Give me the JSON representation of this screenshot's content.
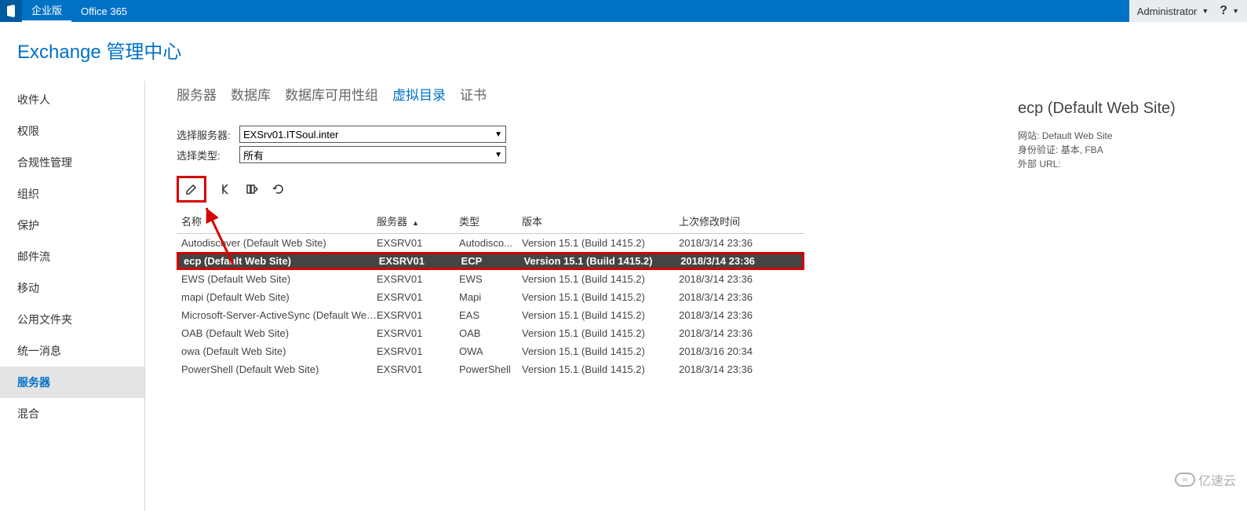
{
  "topbar": {
    "edition": "企业版",
    "office": "Office 365",
    "user": "Administrator"
  },
  "page_title": "Exchange 管理中心",
  "sidebar": {
    "items": [
      {
        "label": "收件人"
      },
      {
        "label": "权限"
      },
      {
        "label": "合规性管理"
      },
      {
        "label": "组织"
      },
      {
        "label": "保护"
      },
      {
        "label": "邮件流"
      },
      {
        "label": "移动"
      },
      {
        "label": "公用文件夹"
      },
      {
        "label": "统一消息"
      },
      {
        "label": "服务器",
        "selected": true
      },
      {
        "label": "混合"
      }
    ]
  },
  "tabs": {
    "items": [
      {
        "label": "服务器"
      },
      {
        "label": "数据库"
      },
      {
        "label": "数据库可用性组"
      },
      {
        "label": "虚拟目录",
        "active": true
      },
      {
        "label": "证书"
      }
    ]
  },
  "filters": {
    "server_label": "选择服务器:",
    "server_value": "EXSrv01.ITSoul.inter",
    "type_label": "选择类型:",
    "type_value": "所有"
  },
  "table": {
    "headers": {
      "name": "名称",
      "server": "服务器",
      "type": "类型",
      "version": "版本",
      "modified": "上次修改时间"
    },
    "rows": [
      {
        "name": "Autodiscover (Default Web Site)",
        "server": "EXSRV01",
        "type": "Autodisco...",
        "version": "Version 15.1 (Build 1415.2)",
        "modified": "2018/3/14 23:36"
      },
      {
        "name": "ecp (Default Web Site)",
        "server": "EXSRV01",
        "type": "ECP",
        "version": "Version 15.1 (Build 1415.2)",
        "modified": "2018/3/14 23:36",
        "selected": true
      },
      {
        "name": "EWS (Default Web Site)",
        "server": "EXSRV01",
        "type": "EWS",
        "version": "Version 15.1 (Build 1415.2)",
        "modified": "2018/3/14 23:36"
      },
      {
        "name": "mapi (Default Web Site)",
        "server": "EXSRV01",
        "type": "Mapi",
        "version": "Version 15.1 (Build 1415.2)",
        "modified": "2018/3/14 23:36"
      },
      {
        "name": "Microsoft-Server-ActiveSync (Default Web S...",
        "server": "EXSRV01",
        "type": "EAS",
        "version": "Version 15.1 (Build 1415.2)",
        "modified": "2018/3/14 23:36"
      },
      {
        "name": "OAB (Default Web Site)",
        "server": "EXSRV01",
        "type": "OAB",
        "version": "Version 15.1 (Build 1415.2)",
        "modified": "2018/3/14 23:36"
      },
      {
        "name": "owa (Default Web Site)",
        "server": "EXSRV01",
        "type": "OWA",
        "version": "Version 15.1 (Build 1415.2)",
        "modified": "2018/3/16 20:34"
      },
      {
        "name": "PowerShell (Default Web Site)",
        "server": "EXSRV01",
        "type": "PowerShell",
        "version": "Version 15.1 (Build 1415.2)",
        "modified": "2018/3/14 23:36"
      }
    ]
  },
  "detail": {
    "title": "ecp (Default Web Site)",
    "site_label": "网站:",
    "site_value": "Default Web Site",
    "auth_label": "身份验证:",
    "auth_value": "基本, FBA",
    "ext_label": "外部 URL:",
    "ext_value": ""
  },
  "watermark": "亿速云"
}
